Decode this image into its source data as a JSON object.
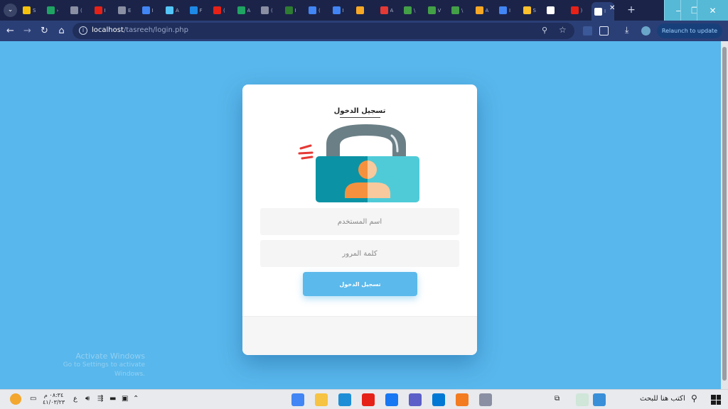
{
  "browser": {
    "tabs": [
      {
        "label": "S",
        "color": "#f4c20d"
      },
      {
        "label": "›",
        "color": "#1fa463"
      },
      {
        "label": "(",
        "color": "#8a8fa3"
      },
      {
        "label": "I",
        "color": "#e62117"
      },
      {
        "label": "E",
        "color": "#8a8fa3"
      },
      {
        "label": "I",
        "color": "#4285f4"
      },
      {
        "label": "A",
        "color": "#54c5f8"
      },
      {
        "label": "F",
        "color": "#1e88e5"
      },
      {
        "label": "(",
        "color": "#e62117"
      },
      {
        "label": "A",
        "color": "#1fa463"
      },
      {
        "label": "(",
        "color": "#8a8fa3"
      },
      {
        "label": "I",
        "color": "#2e7d32"
      },
      {
        "label": "(",
        "color": "#4285f4"
      },
      {
        "label": "I",
        "color": "#4285f4"
      },
      {
        "label": "",
        "color": "#f9a825"
      },
      {
        "label": "A",
        "color": "#e53935"
      },
      {
        "label": "\\",
        "color": "#43a047"
      },
      {
        "label": "V",
        "color": "#43a047"
      },
      {
        "label": "\\",
        "color": "#43a047"
      },
      {
        "label": "A",
        "color": "#f9a825"
      },
      {
        "label": "I",
        "color": "#4285f4"
      },
      {
        "label": "S",
        "color": "#fbc02d"
      },
      {
        "label": "",
        "color": "#ffffff"
      },
      {
        "label": ")",
        "color": "#e62117"
      },
      {
        "label": "I",
        "color": "#ffffff"
      }
    ],
    "active_close": "✕",
    "new_tab": "+",
    "window_controls": {
      "minimize": "—",
      "restore": "❐",
      "close": "✕"
    },
    "nav": {
      "back": "←",
      "forward": "→",
      "reload": "↻",
      "home": "⌂"
    },
    "url": {
      "host": "localhost",
      "path": "/tasreeh/login.php"
    },
    "relaunch_label": "Relaunch to update"
  },
  "login": {
    "title": "تسجيل الدخول",
    "username_placeholder": "اسم المستخدم",
    "password_placeholder": "كلمة المرور",
    "button_label": "تسجيل الدخول"
  },
  "watermark": {
    "title": "Activate Windows",
    "subtitle": "Go to Settings to activate Windows."
  },
  "taskbar": {
    "search_placeholder": "اكتب هنا للبحث",
    "time": "٠٨:٣٤ م",
    "date": "٤١/٠٣/٢٣",
    "lang": "ع",
    "apps": [
      {
        "name": "chrome",
        "color": "#4285f4"
      },
      {
        "name": "file-explorer",
        "color": "#f6c342"
      },
      {
        "name": "edge",
        "color": "#1e8fd6"
      },
      {
        "name": "youtube",
        "color": "#e62117"
      },
      {
        "name": "facebook",
        "color": "#1877f2"
      },
      {
        "name": "teams",
        "color": "#5b5fc7"
      },
      {
        "name": "vscode",
        "color": "#0078d4"
      },
      {
        "name": "g-app",
        "color": "#f37b20"
      },
      {
        "name": "paint",
        "color": "#8a8fa3"
      }
    ]
  },
  "colors": {
    "page_bg": "#58b7ec",
    "accent": "#5bb9eb",
    "lock_shackle": "#6b7f86",
    "lock_body_left": "#0b93a5",
    "lock_body_right": "#4fcbd8",
    "person_left": "#f5913e",
    "person_right": "#f8c99c"
  }
}
